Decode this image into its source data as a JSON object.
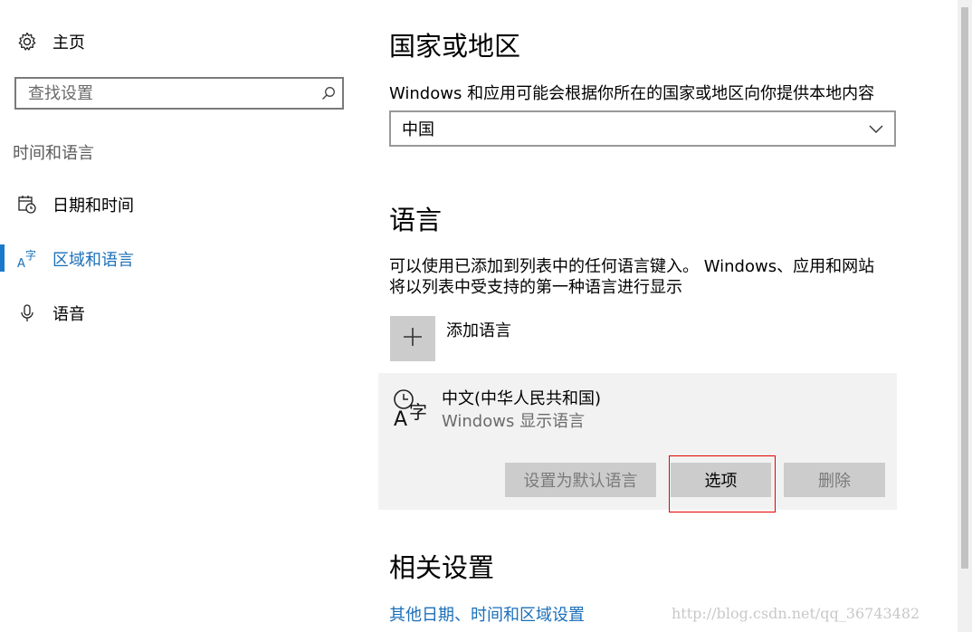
{
  "sidebar": {
    "home_label": "主页",
    "search_placeholder": "查找设置",
    "section_title": "时间和语言",
    "items": [
      {
        "label": "日期和时间",
        "icon": "calendar-clock-icon"
      },
      {
        "label": "区域和语言",
        "icon": "language-icon",
        "selected": true
      },
      {
        "label": "语音",
        "icon": "microphone-icon"
      }
    ]
  },
  "region": {
    "title": "国家或地区",
    "description": "Windows 和应用可能会根据你所在的国家或地区向你提供本地内容",
    "selected_value": "中国"
  },
  "language": {
    "title": "语言",
    "description_line1": "可以使用已添加到列表中的任何语言键入。 Windows、应用和网站",
    "description_line2": "将以列表中受支持的第一种语言进行显示",
    "add_label": "添加语言",
    "entry": {
      "name": "中文(中华人民共和国)",
      "subtitle": "Windows 显示语言",
      "buttons": {
        "set_default": "设置为默认语言",
        "options": "选项",
        "remove": "删除"
      }
    }
  },
  "related": {
    "title": "相关设置",
    "link": "其他日期、时间和区域设置"
  },
  "watermark": "http://blog.csdn.net/qq_36743482",
  "colors": {
    "accent": "#1979ca",
    "link": "#1b6fb9",
    "highlight": "#e60000"
  }
}
